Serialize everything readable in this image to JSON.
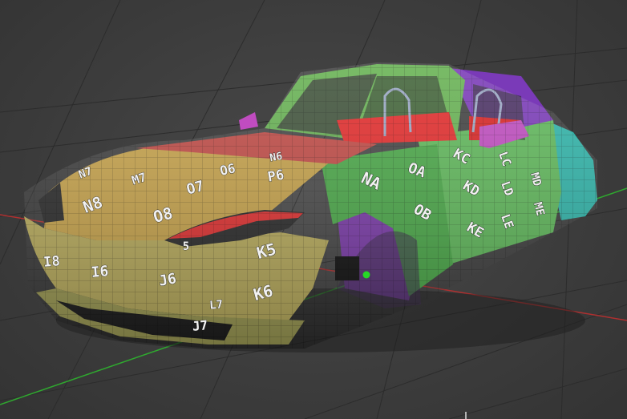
{
  "viewport": {
    "colors": {
      "background": "#3d3d3d",
      "grid": "#2b2b2b",
      "axis_x": "#b03030",
      "axis_y": "#2fa82f",
      "gizmo": "#26d826"
    }
  },
  "uv_labels": [
    {
      "text": "N8"
    },
    {
      "text": "O8"
    },
    {
      "text": "O7"
    },
    {
      "text": "O6"
    },
    {
      "text": "P6"
    },
    {
      "text": "N7"
    },
    {
      "text": "M7"
    },
    {
      "text": "N6"
    },
    {
      "text": "NA"
    },
    {
      "text": "OA"
    },
    {
      "text": "OB"
    },
    {
      "text": "KC"
    },
    {
      "text": "KD"
    },
    {
      "text": "KE"
    },
    {
      "text": "LC"
    },
    {
      "text": "LD"
    },
    {
      "text": "LE"
    },
    {
      "text": "MD"
    },
    {
      "text": "ME"
    },
    {
      "text": "K5"
    },
    {
      "text": "K6"
    },
    {
      "text": "J6"
    },
    {
      "text": "I6"
    },
    {
      "text": "I8"
    },
    {
      "text": "J7"
    },
    {
      "text": "L7"
    },
    {
      "text": "5"
    }
  ]
}
